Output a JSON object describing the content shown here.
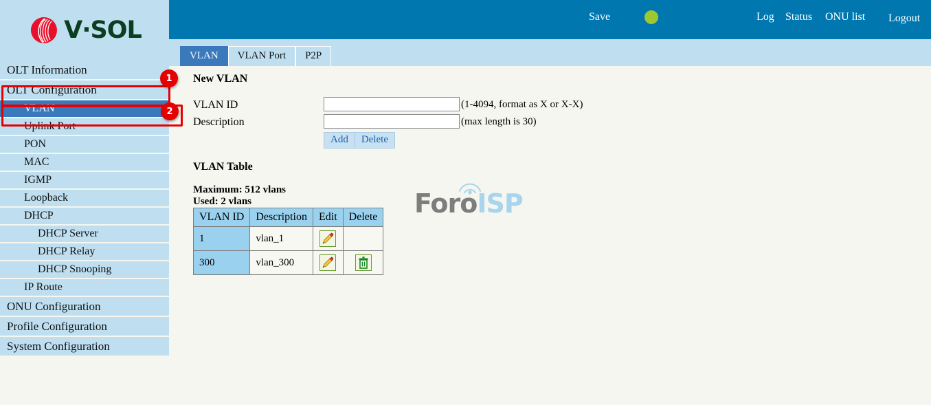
{
  "brand": {
    "name": "V·SOL",
    "logo_icon": "vsol-sphere-logo"
  },
  "topnav": {
    "save_label": "Save",
    "status_indicator_color": "#9fc82e",
    "links": [
      {
        "label": "Log"
      },
      {
        "label": "Status"
      },
      {
        "label": "ONU list"
      },
      {
        "label": "Logout"
      }
    ]
  },
  "tabs": [
    {
      "label": "VLAN",
      "active": true
    },
    {
      "label": "VLAN Port",
      "active": false
    },
    {
      "label": "P2P",
      "active": false
    }
  ],
  "sidebar": {
    "items": [
      {
        "label": "OLT Information",
        "level": 1,
        "selected": false
      },
      {
        "label": "OLT Configuration",
        "level": 1,
        "selected": false
      },
      {
        "label": "VLAN",
        "level": 2,
        "selected": true
      },
      {
        "label": "Uplink Port",
        "level": 2,
        "selected": false
      },
      {
        "label": "PON",
        "level": 2,
        "selected": false
      },
      {
        "label": "MAC",
        "level": 2,
        "selected": false
      },
      {
        "label": "IGMP",
        "level": 2,
        "selected": false
      },
      {
        "label": "Loopback",
        "level": 2,
        "selected": false
      },
      {
        "label": "DHCP",
        "level": 2,
        "selected": false
      },
      {
        "label": "DHCP Server",
        "level": 3,
        "selected": false
      },
      {
        "label": "DHCP Relay",
        "level": 3,
        "selected": false
      },
      {
        "label": "DHCP Snooping",
        "level": 3,
        "selected": false
      },
      {
        "label": "IP Route",
        "level": 2,
        "selected": false
      },
      {
        "label": "ONU Configuration",
        "level": 1,
        "selected": false
      },
      {
        "label": "Profile Configuration",
        "level": 1,
        "selected": false
      },
      {
        "label": "System Configuration",
        "level": 1,
        "selected": false
      }
    ]
  },
  "annotations": {
    "color": "#e60000",
    "badges": [
      {
        "number": "1",
        "target": "OLT Configuration"
      },
      {
        "number": "2",
        "target": "VLAN"
      }
    ]
  },
  "main": {
    "new_vlan": {
      "heading": "New VLAN",
      "vlan_id_label": "VLAN ID",
      "vlan_id_value": "",
      "vlan_id_hint": "(1-4094, format as X or X-X)",
      "description_label": "Description",
      "description_value": "",
      "description_hint": "(max length is 30)",
      "add_label": "Add",
      "delete_label": "Delete"
    },
    "vlan_table": {
      "heading": "VLAN Table",
      "maximum_text": "Maximum: 512 vlans",
      "used_text": "Used: 2 vlans",
      "columns": [
        "VLAN ID",
        "Description",
        "Edit",
        "Delete"
      ],
      "rows": [
        {
          "vlan_id": "1",
          "description": "vlan_1",
          "edit_icon": "pencil-edit-icon",
          "delete_icon": ""
        },
        {
          "vlan_id": "300",
          "description": "vlan_300",
          "edit_icon": "pencil-edit-icon",
          "delete_icon": "trash-delete-icon"
        }
      ]
    }
  },
  "watermark": {
    "part1": "Foro",
    "part2": "ISP"
  }
}
